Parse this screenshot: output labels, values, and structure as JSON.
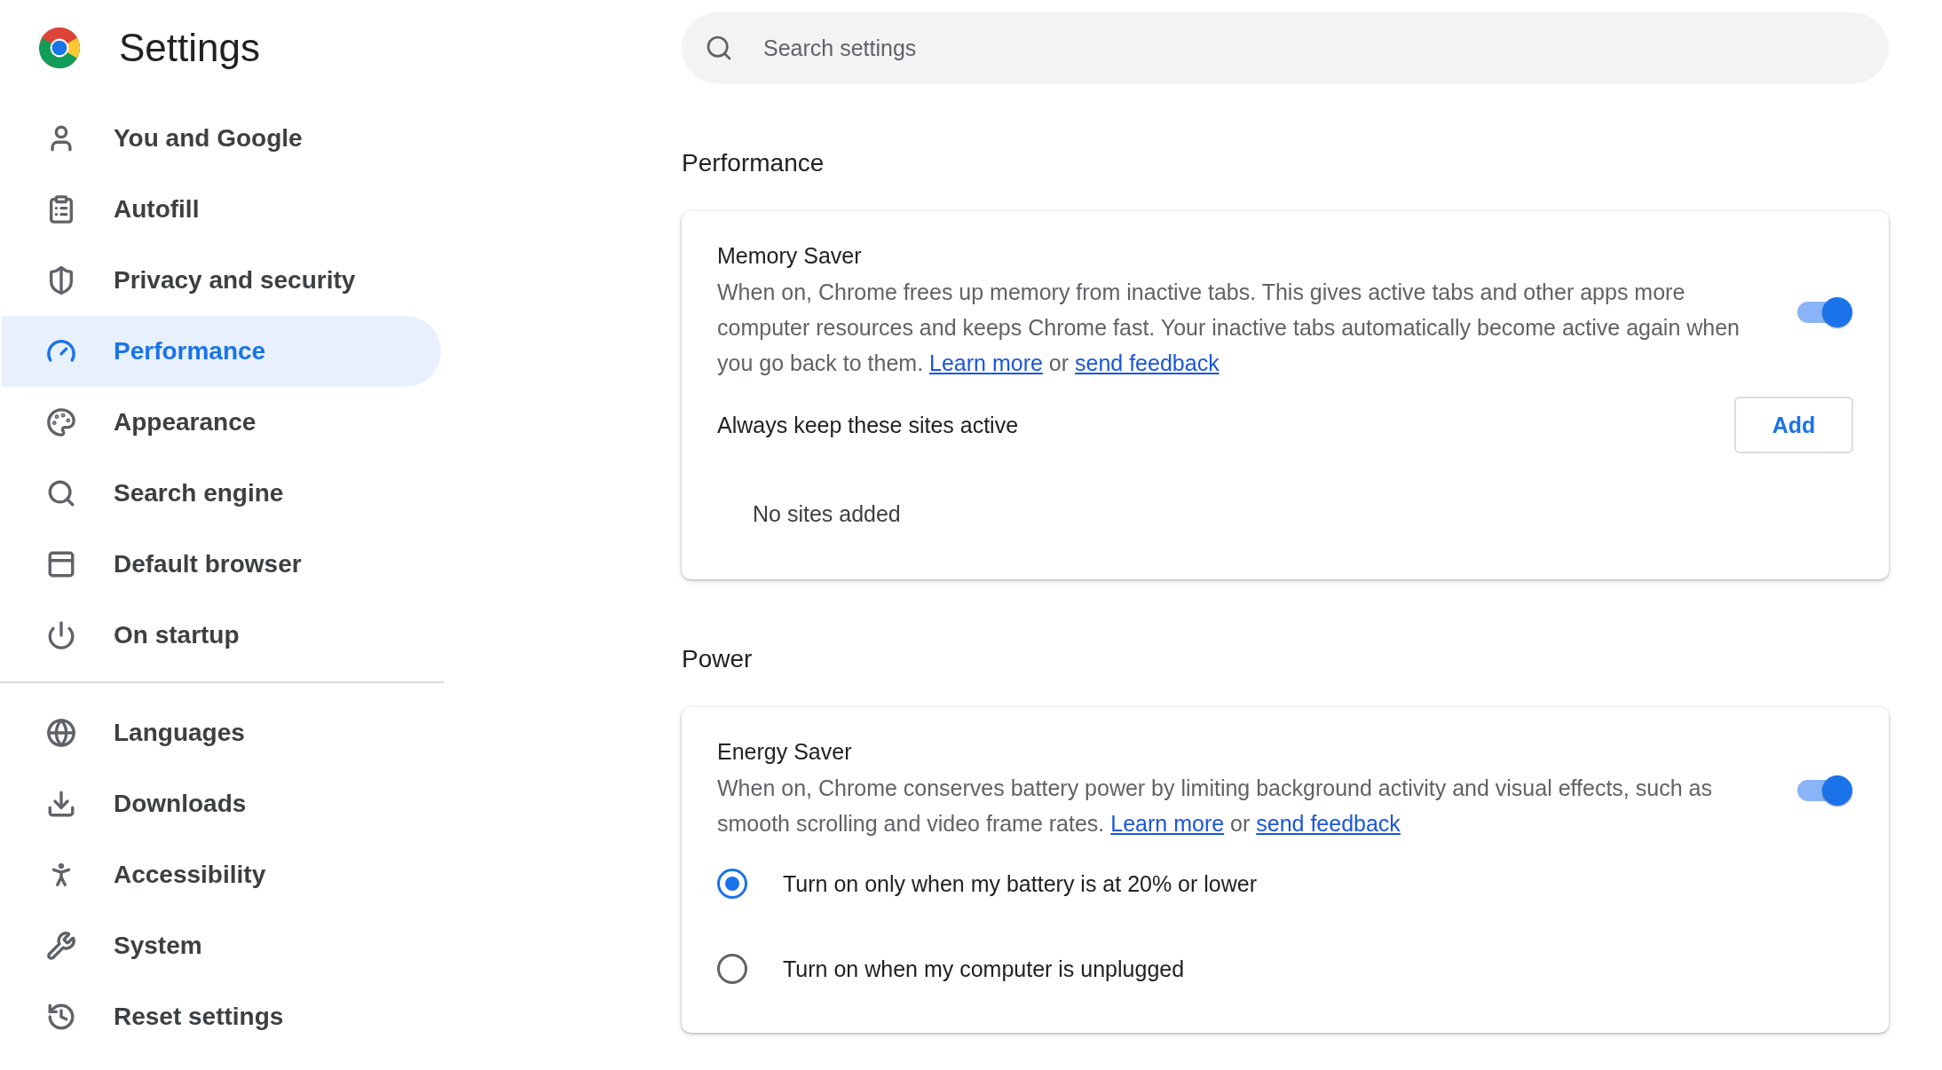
{
  "header": {
    "title": "Settings"
  },
  "search": {
    "placeholder": "Search settings"
  },
  "sidebar": {
    "groups": [
      {
        "items": [
          {
            "label": "You and Google",
            "selected": false
          },
          {
            "label": "Autofill",
            "selected": false
          },
          {
            "label": "Privacy and security",
            "selected": false
          },
          {
            "label": "Performance",
            "selected": true
          },
          {
            "label": "Appearance",
            "selected": false
          },
          {
            "label": "Search engine",
            "selected": false
          },
          {
            "label": "Default browser",
            "selected": false
          },
          {
            "label": "On startup",
            "selected": false
          }
        ]
      },
      {
        "items": [
          {
            "label": "Languages",
            "selected": false
          },
          {
            "label": "Downloads",
            "selected": false
          },
          {
            "label": "Accessibility",
            "selected": false
          },
          {
            "label": "System",
            "selected": false
          },
          {
            "label": "Reset settings",
            "selected": false
          }
        ]
      }
    ]
  },
  "sections": [
    {
      "heading": "Performance",
      "card": {
        "title": "Memory Saver",
        "on": true,
        "description": [
          {
            "kind": "text",
            "text": "When on, Chrome frees up memory from inactive tabs. This gives active tabs and other apps more computer resources and keeps Chrome fast. Your inactive tabs automatically become active again when you go back to them. "
          },
          {
            "kind": "link",
            "text": "Learn more"
          },
          {
            "kind": "text",
            "text": " or "
          },
          {
            "kind": "link",
            "text": "send feedback"
          }
        ],
        "rows": [
          {
            "kind": "action",
            "label": "Always keep these sites active",
            "button": "Add"
          },
          {
            "kind": "note",
            "label": "No sites added"
          }
        ]
      }
    },
    {
      "heading": "Power",
      "card": {
        "title": "Energy Saver",
        "on": true,
        "description": [
          {
            "kind": "text",
            "text": "When on, Chrome conserves battery power by limiting background activity and visual effects, such as smooth scrolling and video frame rates. "
          },
          {
            "kind": "link",
            "text": "Learn more"
          },
          {
            "kind": "text",
            "text": " or "
          },
          {
            "kind": "link",
            "text": "send feedback"
          }
        ],
        "rows": [
          {
            "kind": "radio",
            "label": "Turn on only when my battery is at 20% or lower",
            "selected": true
          },
          {
            "kind": "radio",
            "label": "Turn on when my computer is unplugged",
            "selected": false
          }
        ]
      }
    }
  ]
}
